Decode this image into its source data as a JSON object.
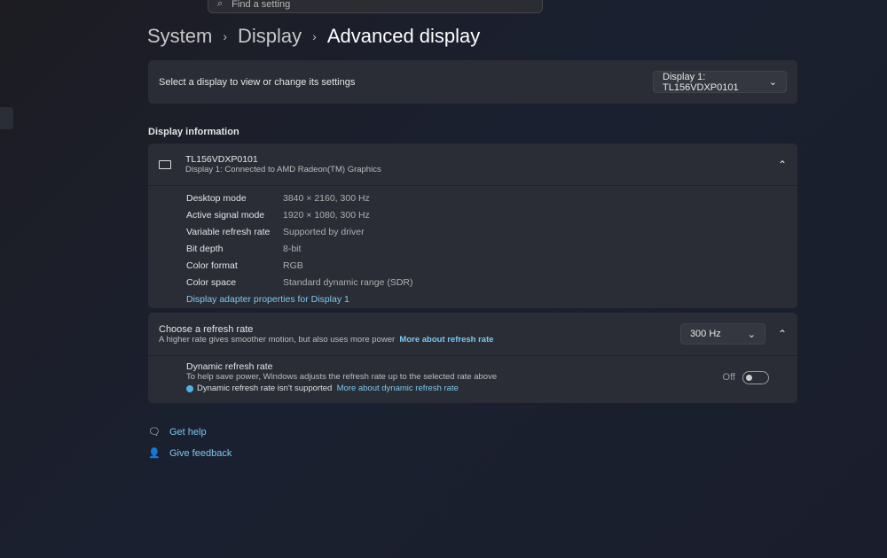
{
  "search": {
    "placeholder": "Find a setting"
  },
  "breadcrumb": [
    "System",
    "Display",
    "Advanced display"
  ],
  "select_display": {
    "label": "Select a display to view or change its settings",
    "value": "Display 1: TL156VDXP0101"
  },
  "display_info": {
    "heading": "Display information",
    "name": "TL156VDXP0101",
    "subtitle": "Display 1: Connected to AMD Radeon(TM) Graphics",
    "rows": [
      {
        "k": "Desktop mode",
        "v": "3840 × 2160, 300 Hz"
      },
      {
        "k": "Active signal mode",
        "v": "1920 × 1080, 300 Hz"
      },
      {
        "k": "Variable refresh rate",
        "v": "Supported by driver"
      },
      {
        "k": "Bit depth",
        "v": "8-bit"
      },
      {
        "k": "Color format",
        "v": "RGB"
      },
      {
        "k": "Color space",
        "v": "Standard dynamic range (SDR)"
      }
    ],
    "adapter_link": "Display adapter properties for Display 1"
  },
  "refresh": {
    "title": "Choose a refresh rate",
    "desc": "A higher rate gives smoother motion, but also uses more power",
    "link": "More about refresh rate",
    "value": "300 Hz",
    "dynamic_title": "Dynamic refresh rate",
    "dynamic_desc": "To help save power, Windows adjusts the refresh rate up to the selected rate above",
    "dynamic_note": "Dynamic refresh rate isn't supported",
    "dynamic_link": "More about dynamic refresh rate",
    "toggle_label": "Off"
  },
  "footer": {
    "help": "Get help",
    "feedback": "Give feedback"
  }
}
